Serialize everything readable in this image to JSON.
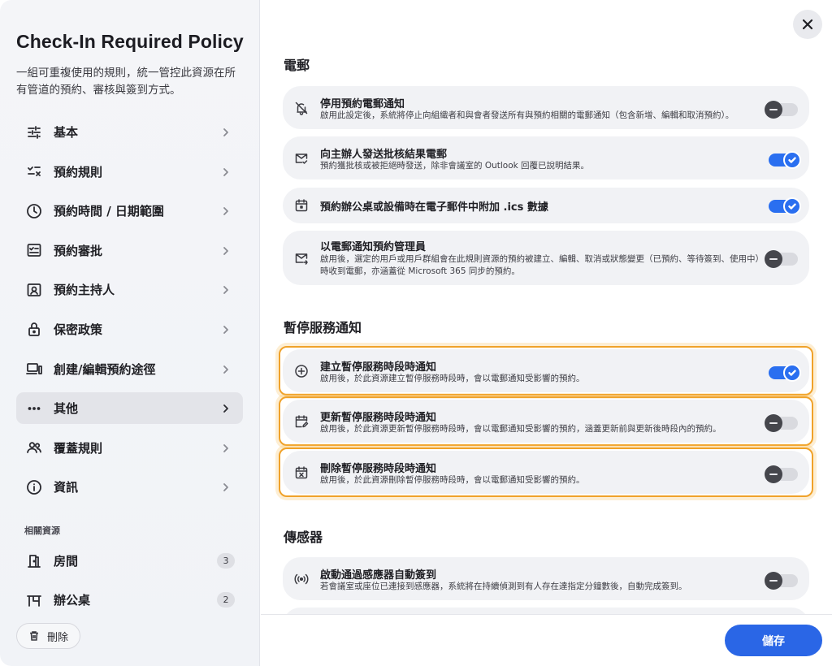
{
  "sidebar": {
    "title": "Check-In Required Policy",
    "description": "一組可重複使用的規則，統一管控此資源在所有管道的預約、審核與簽到方式。",
    "items": [
      {
        "label": "基本"
      },
      {
        "label": "預約規則"
      },
      {
        "label": "預約時間 / 日期範圍"
      },
      {
        "label": "預約審批"
      },
      {
        "label": "預約主持人"
      },
      {
        "label": "保密政策"
      },
      {
        "label": "創建/編輯預約途徑"
      },
      {
        "label": "其他"
      },
      {
        "label": "覆蓋規則"
      },
      {
        "label": "資訊"
      }
    ],
    "active_item": "其他",
    "related_section_label": "相關資源",
    "related": [
      {
        "label": "房間",
        "count": "3"
      },
      {
        "label": "辦公桌",
        "count": "2"
      }
    ],
    "delete_label": "刪除"
  },
  "main": {
    "sections": [
      {
        "title": "電郵",
        "settings": [
          {
            "title": "停用預約電郵通知",
            "description": "啟用此設定後，系統將停止向組織者和與會者發送所有與預約相關的電郵通知（包含新增、編輯和取消預約）。",
            "enabled": false
          },
          {
            "title": "向主辦人發送批核結果電郵",
            "description": "預約獲批核或被拒絕時發送，除非會議室的 Outlook 回覆已說明結果。",
            "enabled": true
          },
          {
            "title": "預約辦公桌或設備時在電子郵件中附加 .ics 數據",
            "description": "",
            "enabled": true
          },
          {
            "title": "以電郵通知預約管理員",
            "description": "啟用後，選定的用戶或用戶群組會在此規則資源的預約被建立、編輯、取消或狀態變更（已預約、等待簽到、使用中）時收到電郵，亦涵蓋從 Microsoft 365 同步的預約。",
            "enabled": false
          }
        ]
      },
      {
        "title": "暫停服務通知",
        "settings": [
          {
            "title": "建立暫停服務時段時通知",
            "description": "啟用後，於此資源建立暫停服務時段時，會以電郵通知受影響的預約。",
            "enabled": true
          },
          {
            "title": "更新暫停服務時段時通知",
            "description": "啟用後，於此資源更新暫停服務時段時，會以電郵通知受影響的預約，涵蓋更新前與更新後時段內的預約。",
            "enabled": false
          },
          {
            "title": "刪除暫停服務時段時通知",
            "description": "啟用後，於此資源刪除暫停服務時段時，會以電郵通知受影響的預約。",
            "enabled": false
          }
        ]
      },
      {
        "title": "傳感器",
        "settings": [
          {
            "title": "啟動通過感應器自動簽到",
            "description": "若會議室或座位已連接到感應器，系統將在持續偵測到有人存在達指定分鐘數後，自動完成簽到。",
            "enabled": false
          }
        ]
      }
    ]
  },
  "footer": {
    "save_label": "儲存"
  },
  "colors": {
    "accent": "#2a66e6",
    "highlight": "#f0a22a"
  }
}
